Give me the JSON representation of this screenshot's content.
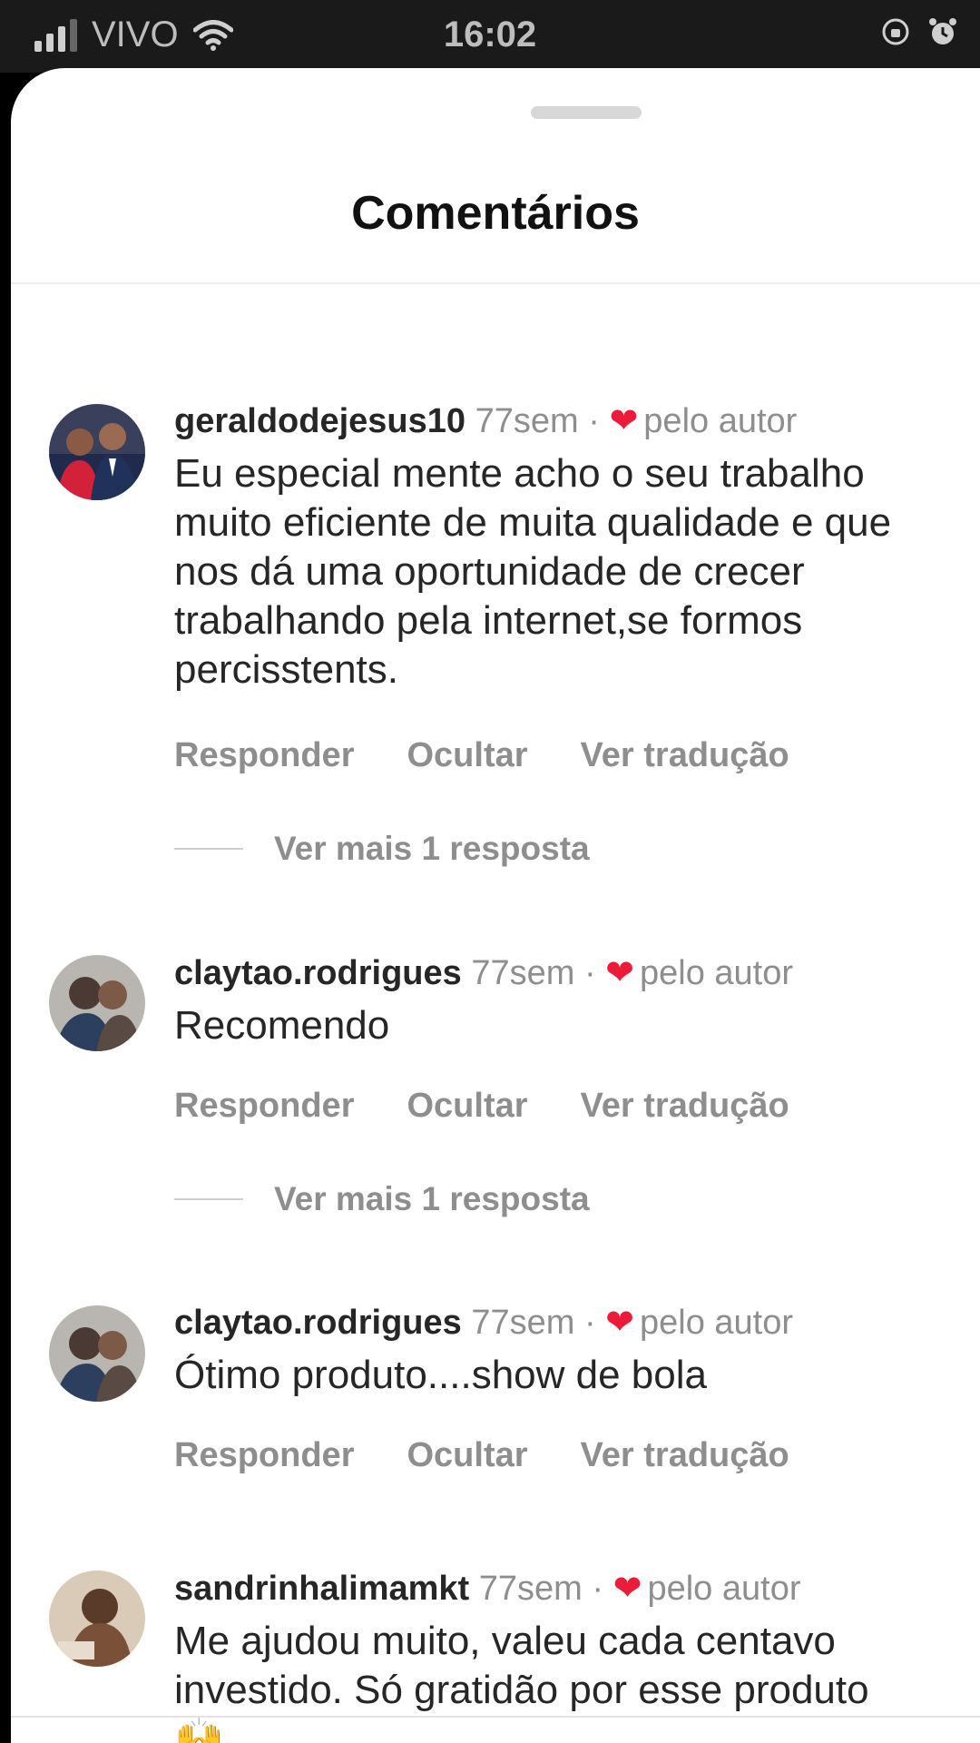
{
  "status_bar": {
    "carrier": "VIVO",
    "time": "16:02"
  },
  "sheet": {
    "title": "Comentários"
  },
  "actions": {
    "reply": "Responder",
    "hide": "Ocultar",
    "translate": "Ver tradução"
  },
  "comments": [
    {
      "username": "geraldodejesus10",
      "time": "77sem",
      "separator": "·",
      "liked_by": "pelo autor",
      "text": "Eu especial mente acho o seu trabalho muito eficiente de muita qualidade e que nos dá uma oportunidade de crecer trabalhando pela internet,se formos percisstents.",
      "more_replies": "Ver mais 1 resposta"
    },
    {
      "username": "claytao.rodrigues",
      "time": "77sem",
      "separator": "·",
      "liked_by": "pelo autor",
      "text": "Recomendo",
      "more_replies": "Ver mais 1 resposta"
    },
    {
      "username": "claytao.rodrigues",
      "time": "77sem",
      "separator": "·",
      "liked_by": "pelo autor",
      "text": "Ótimo produto....show de bola"
    },
    {
      "username": "sandrinhalimamkt",
      "time": "77sem",
      "separator": "·",
      "liked_by": "pelo autor",
      "text": "Me ajudou muito, valeu cada centavo investido. Só gratidão por esse produto",
      "emoji": "🙌"
    }
  ],
  "colors": {
    "heart": "#ed1b3a",
    "muted": "#8e8e8e",
    "text": "#262626"
  }
}
